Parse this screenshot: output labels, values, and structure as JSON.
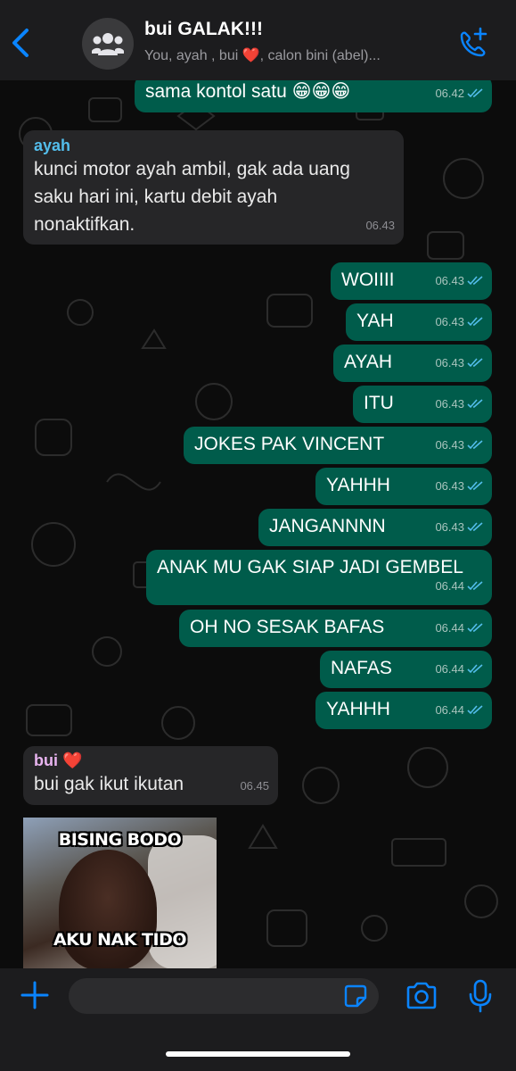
{
  "header": {
    "title": "bui GALAK!!!",
    "subtitle": "You, ayah , bui ❤️, calon bini (abel)..."
  },
  "messages": [
    {
      "dir": "out",
      "text": "sama kontol satu 😁😁😁",
      "time": "06.42"
    },
    {
      "dir": "in",
      "sender": "ayah",
      "lines": [
        "kunci motor ayah ambil, gak ada uang",
        "saku hari ini, kartu debit ayah",
        "nonaktifkan."
      ],
      "time": "06.43"
    },
    {
      "dir": "out",
      "text": "WOIIII",
      "time": "06.43"
    },
    {
      "dir": "out",
      "text": "YAH",
      "time": "06.43"
    },
    {
      "dir": "out",
      "text": "AYAH",
      "time": "06.43"
    },
    {
      "dir": "out",
      "text": "ITU",
      "time": "06.43"
    },
    {
      "dir": "out",
      "text": "JOKES PAK VINCENT",
      "time": "06.43"
    },
    {
      "dir": "out",
      "text": "YAHHH",
      "time": "06.43"
    },
    {
      "dir": "out",
      "text": "JANGANNNN",
      "time": "06.43"
    },
    {
      "dir": "out",
      "text": "ANAK MU GAK SIAP JADI GEMBEL",
      "time": "06.44"
    },
    {
      "dir": "out",
      "text": "OH NO SESAK BAFAS",
      "time": "06.44"
    },
    {
      "dir": "out",
      "text": "NAFAS",
      "time": "06.44"
    },
    {
      "dir": "out",
      "text": "YAHHH",
      "time": "06.44"
    },
    {
      "dir": "in",
      "sender": "bui ❤️",
      "lines": [
        "bui gak ikut ikutan"
      ],
      "time": "06.45"
    }
  ],
  "image_message": {
    "caption_top": "BISING BODO",
    "caption_bottom": "AKU NAK TIDO"
  },
  "colors": {
    "accent": "#0a84ff",
    "outgoing_bubble": "#005c4b",
    "incoming_bubble": "#262628",
    "sender_ayah": "#53bdeb",
    "sender_bui": "#e8b4f0",
    "read_ticks": "#53bdeb"
  },
  "icons": {
    "back": "chevron-left-icon",
    "avatar": "group-avatar-icon",
    "call": "add-call-icon",
    "attach": "plus-icon",
    "sticker": "sticker-icon",
    "camera": "camera-icon",
    "mic": "microphone-icon"
  }
}
